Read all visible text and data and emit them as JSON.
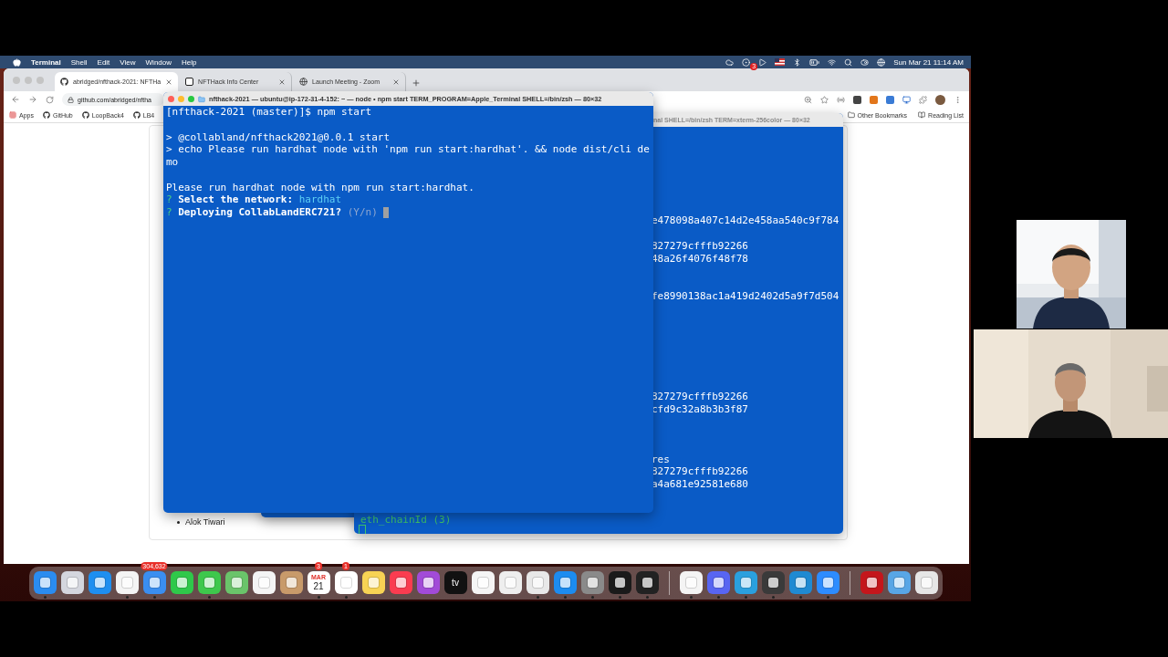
{
  "menu_bar": {
    "app_name": "Terminal",
    "menus": [
      "Shell",
      "Edit",
      "View",
      "Window",
      "Help"
    ],
    "status_badge": "3",
    "clock": "Sun Mar 21  11:14 AM"
  },
  "browser": {
    "tabs": [
      {
        "label": "abridged/nfthack-2021: NFTHa",
        "selected": true
      },
      {
        "label": "NFTHack Info Center",
        "selected": false
      },
      {
        "label": "Launch Meeting - Zoom",
        "selected": false
      }
    ],
    "address": "github.com/abridged/nftha",
    "bookmarks": [
      "Apps",
      "GitHub",
      "LoopBack4",
      "LB4"
    ],
    "bookmarks_right": [
      "Other Bookmarks",
      "Reading List"
    ],
    "page_list": [
      "Alok Tiwari"
    ]
  },
  "terminal_back": {
    "title": "nal SHELL=/bin/zsh TERM=xterm-256color — 80×32",
    "blocks": [
      [
        "e478098a407c14d2e458aa540c9f784"
      ],
      [
        "827279cfffb92266",
        "48a26f4076f48f78"
      ],
      [
        "fe8990138ac1a419d2402d5a9f7d504"
      ],
      [
        "827279cfffb92266",
        "cfd9c32a8b3b3f87"
      ],
      [
        "res",
        "827279cfffb92266",
        "a4a681e92581e680"
      ]
    ],
    "last_line": "eth_chainId (3)"
  },
  "terminal_front": {
    "title": "nfthack-2021 — ubuntu@ip-172-31-4-152: ~ — node • npm start TERM_PROGRAM=Apple_Terminal SHELL=/bin/zsh — 80×32",
    "blocks": [
      [
        {
          "kind": "plain",
          "text": "[nfthack-2021 (master)]$ npm start"
        }
      ],
      [
        {
          "kind": "plain",
          "text": "> @collabland/nfthack2021@0.0.1 start"
        },
        {
          "kind": "plain",
          "text": "> echo Please run hardhat node with 'npm run start:hardhat'. && node dist/cli de"
        },
        {
          "kind": "plain",
          "text": "mo"
        }
      ],
      [
        {
          "kind": "plain",
          "text": "Please run hardhat node with npm run start:hardhat."
        },
        {
          "kind": "question",
          "mark": "?",
          "label": "Select the network:",
          "answer": "hardhat"
        },
        {
          "kind": "question",
          "mark": "?",
          "label": "Deploying CollabLandERC721?",
          "hint": "(Y/n)",
          "cursor": true
        }
      ]
    ]
  },
  "dock": {
    "sections": [
      {
        "items": [
          {
            "color": "#2a8cf0",
            "running": true
          },
          {
            "color": "#d4d6de",
            "running": false
          },
          {
            "color": "#1e8ff0",
            "running": false
          },
          {
            "color": "#f4f4f4",
            "running": true
          },
          {
            "color": "#3a8ef0",
            "running": true,
            "badge": "304,632"
          },
          {
            "color": "#2fc84a",
            "running": false
          },
          {
            "color": "#3ec84c",
            "running": true
          },
          {
            "color": "#6ac46a",
            "running": false
          },
          {
            "color": "#f4f4f4",
            "running": false
          },
          {
            "color": "#c89a6a",
            "running": false
          },
          {
            "color": "#ffffff",
            "running": true,
            "label_top": "MAR",
            "label": "21",
            "badge": "3"
          },
          {
            "color": "#ffffff",
            "running": true,
            "badge": "1"
          },
          {
            "color": "#f7d354",
            "running": false
          },
          {
            "color": "#fa3c50",
            "running": false
          },
          {
            "color": "#a24bd8",
            "running": false
          },
          {
            "color": "#111111",
            "running": false,
            "label": "tv"
          },
          {
            "color": "#f5f5f5",
            "running": false
          },
          {
            "color": "#eeeeee",
            "running": false
          },
          {
            "color": "#e8e8e8",
            "running": true
          },
          {
            "color": "#1c8cf0",
            "running": true
          },
          {
            "color": "#8a8a8a",
            "running": true
          },
          {
            "color": "#1a1a1a",
            "running": true
          },
          {
            "color": "#222222",
            "running": true
          }
        ]
      },
      {
        "items": [
          {
            "color": "#f4f4f4",
            "running": true
          },
          {
            "color": "#5865f2",
            "running": true
          },
          {
            "color": "#2aa0de",
            "running": true
          },
          {
            "color": "#3a3a3a",
            "running": true
          },
          {
            "color": "#1f8ad2",
            "running": true
          },
          {
            "color": "#2d8cff",
            "running": true
          }
        ]
      },
      {
        "items": [
          {
            "color": "#c4161c",
            "running": false
          },
          {
            "color": "#58a6e6",
            "running": false
          },
          {
            "color": "#e6e6e6",
            "running": false
          }
        ]
      }
    ]
  }
}
